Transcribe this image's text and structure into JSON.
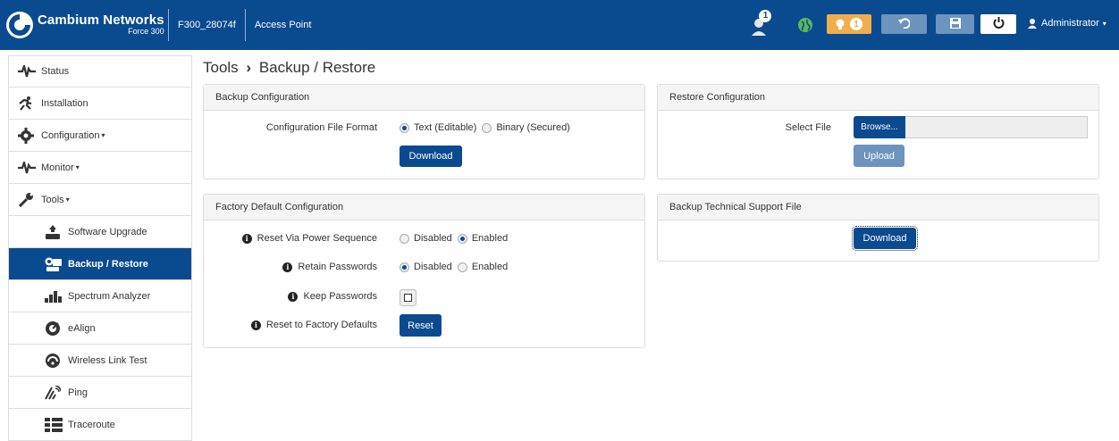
{
  "header": {
    "brand_name": "Cambium Networks",
    "brand_sub": "Force 300",
    "device_name": "F300_28074f",
    "mode": "Access Point",
    "notif_count": "1",
    "alert_count": "1",
    "user": "Administrator",
    "icons": [
      "user-notification-icon",
      "globe-icon",
      "lightbulb-icon",
      "undo-icon",
      "save-icon",
      "power-icon",
      "user-icon"
    ]
  },
  "sidebar": {
    "items": [
      {
        "label": "Status",
        "icon": "status-icon"
      },
      {
        "label": "Installation",
        "icon": "installation-icon"
      },
      {
        "label": "Configuration",
        "icon": "gear-icon"
      },
      {
        "label": "Monitor",
        "icon": "monitor-icon"
      },
      {
        "label": "Tools",
        "icon": "wrench-icon"
      },
      {
        "label": "Software Upgrade",
        "icon": "upgrade-icon"
      },
      {
        "label": "Backup / Restore",
        "icon": "backup-icon"
      },
      {
        "label": "Spectrum Analyzer",
        "icon": "spectrum-icon"
      },
      {
        "label": "eAlign",
        "icon": "ealign-icon"
      },
      {
        "label": "Wireless Link Test",
        "icon": "link-test-icon"
      },
      {
        "label": "Ping",
        "icon": "ping-icon"
      },
      {
        "label": "Traceroute",
        "icon": "traceroute-icon"
      }
    ]
  },
  "page": {
    "title_section": "Tools",
    "title_sep": "›",
    "title_page": "Backup / Restore"
  },
  "backup": {
    "heading": "Backup Configuration",
    "format_label": "Configuration File Format",
    "opt_text": "Text (Editable)",
    "opt_binary": "Binary (Secured)",
    "selected": "text",
    "download": "Download"
  },
  "restore": {
    "heading": "Restore Configuration",
    "select_label": "Select File",
    "browse": "Browse...",
    "upload": "Upload"
  },
  "factory": {
    "heading": "Factory Default Configuration",
    "reset_power_label": "Reset Via Power Sequence",
    "retain_label": "Retain Passwords",
    "keep_label": "Keep Passwords",
    "reset_label": "Reset to Factory Defaults",
    "disabled": "Disabled",
    "enabled": "Enabled",
    "reset_power_value": "enabled",
    "retain_value": "disabled",
    "keep_checked": false,
    "reset_button": "Reset"
  },
  "support": {
    "heading": "Backup Technical Support File",
    "download": "Download"
  },
  "colors": {
    "brand": "#0a4a8f",
    "warning": "#f0ad4e",
    "success": "#5cb85c"
  }
}
